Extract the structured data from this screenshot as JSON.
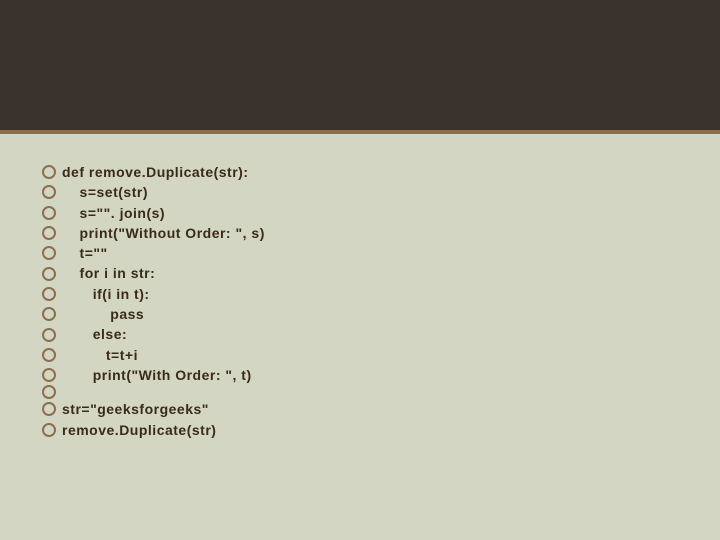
{
  "code_lines": [
    "def remove.Duplicate(str):",
    "    s=set(str)",
    "    s=\"\". join(s)",
    "    print(\"Without Order: \", s)",
    "    t=\"\"",
    "    for i in str:",
    "       if(i in t):",
    "           pass",
    "       else:",
    "          t=t+i",
    "       print(\"With Order: \", t)",
    "",
    "str=\"geeksforgeeks\"",
    "remove.Duplicate(str)"
  ]
}
